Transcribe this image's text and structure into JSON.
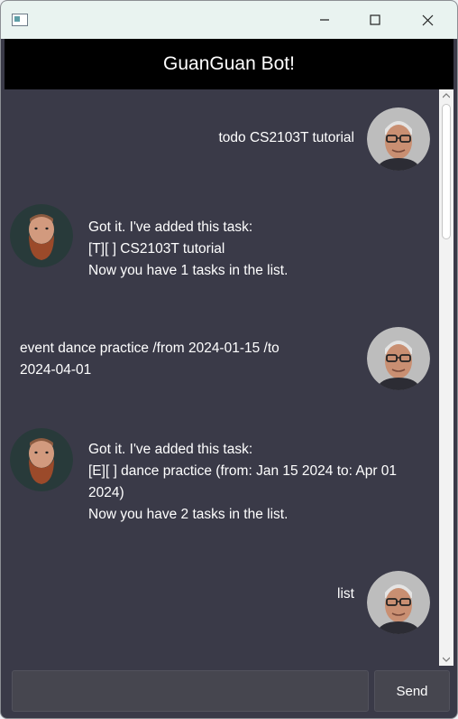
{
  "window": {
    "app_icon": "window-app-icon",
    "controls": {
      "minimize": "minimize-icon",
      "maximize": "maximize-icon",
      "close": "close-icon"
    }
  },
  "header": {
    "title": "GuanGuan Bot!"
  },
  "messages": [
    {
      "sender": "user",
      "text": "todo CS2103T tutorial"
    },
    {
      "sender": "bot",
      "text": "Got it. I've added this task:\n[T][ ] CS2103T tutorial\nNow you have 1 tasks in the list."
    },
    {
      "sender": "user",
      "text": "event dance practice /from 2024-01-15 /to\n2024-04-01"
    },
    {
      "sender": "bot",
      "text": "Got it. I've added this task:\n[E][ ] dance practice (from: Jan 15 2024 to: Apr 01\n2024)\nNow you have 2 tasks in the list."
    },
    {
      "sender": "user",
      "text": "list"
    }
  ],
  "input": {
    "value": "",
    "placeholder": ""
  },
  "send_button": {
    "label": "Send"
  },
  "colors": {
    "chat_bg": "#3a3a48",
    "header_bg": "#000000",
    "titlebar_bg": "#e9f3f0",
    "text": "#ffffff"
  }
}
